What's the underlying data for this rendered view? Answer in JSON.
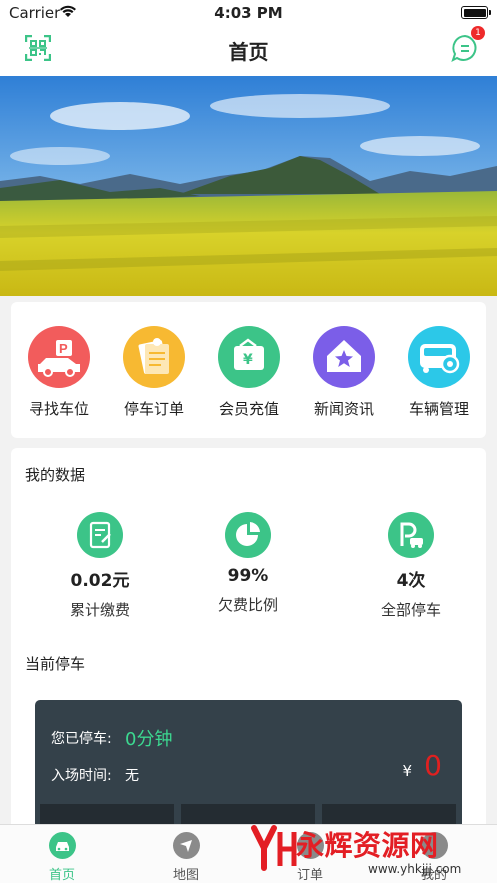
{
  "status_bar": {
    "carrier": "Carrier",
    "time": "4:03 PM"
  },
  "nav": {
    "title": "首页",
    "badge_count": "1"
  },
  "menu": {
    "items": [
      {
        "label": "寻找车位",
        "color": "#f25c5c",
        "icon": "parking-car-icon"
      },
      {
        "label": "停车订单",
        "color": "#f7b932",
        "icon": "order-list-icon"
      },
      {
        "label": "会员充值",
        "color": "#3cc488",
        "icon": "wallet-icon"
      },
      {
        "label": "新闻资讯",
        "color": "#7b5ee8",
        "icon": "news-home-icon"
      },
      {
        "label": "车辆管理",
        "color": "#2cc8e8",
        "icon": "vehicle-settings-icon"
      }
    ]
  },
  "my_data": {
    "title": "我的数据",
    "stats": [
      {
        "value": "0.02元",
        "label": "累计缴费",
        "icon": "payment-doc-icon"
      },
      {
        "value": "99%",
        "label": "欠费比例",
        "icon": "pie-chart-icon"
      },
      {
        "value": "4次",
        "label": "全部停车",
        "icon": "parking-icon"
      }
    ]
  },
  "current_parking": {
    "title": "当前停车",
    "parked_label": "您已停车:",
    "parked_value": "0分钟",
    "entry_label": "入场时间:",
    "entry_value": "无",
    "currency": "¥",
    "amount": "0"
  },
  "tabs": [
    {
      "label": "首页",
      "icon": "car-home-icon",
      "active": true
    },
    {
      "label": "地图",
      "icon": "navigation-icon",
      "active": false
    },
    {
      "label": "订单",
      "icon": "order-icon",
      "active": false
    },
    {
      "label": "我的",
      "icon": "profile-icon",
      "active": false
    }
  ],
  "watermark": {
    "text": "永辉资源网",
    "url": "www.yhkjjj.com"
  },
  "colors": {
    "accent": "#3cc488",
    "panel": "#34414a",
    "alert": "#e02020"
  }
}
